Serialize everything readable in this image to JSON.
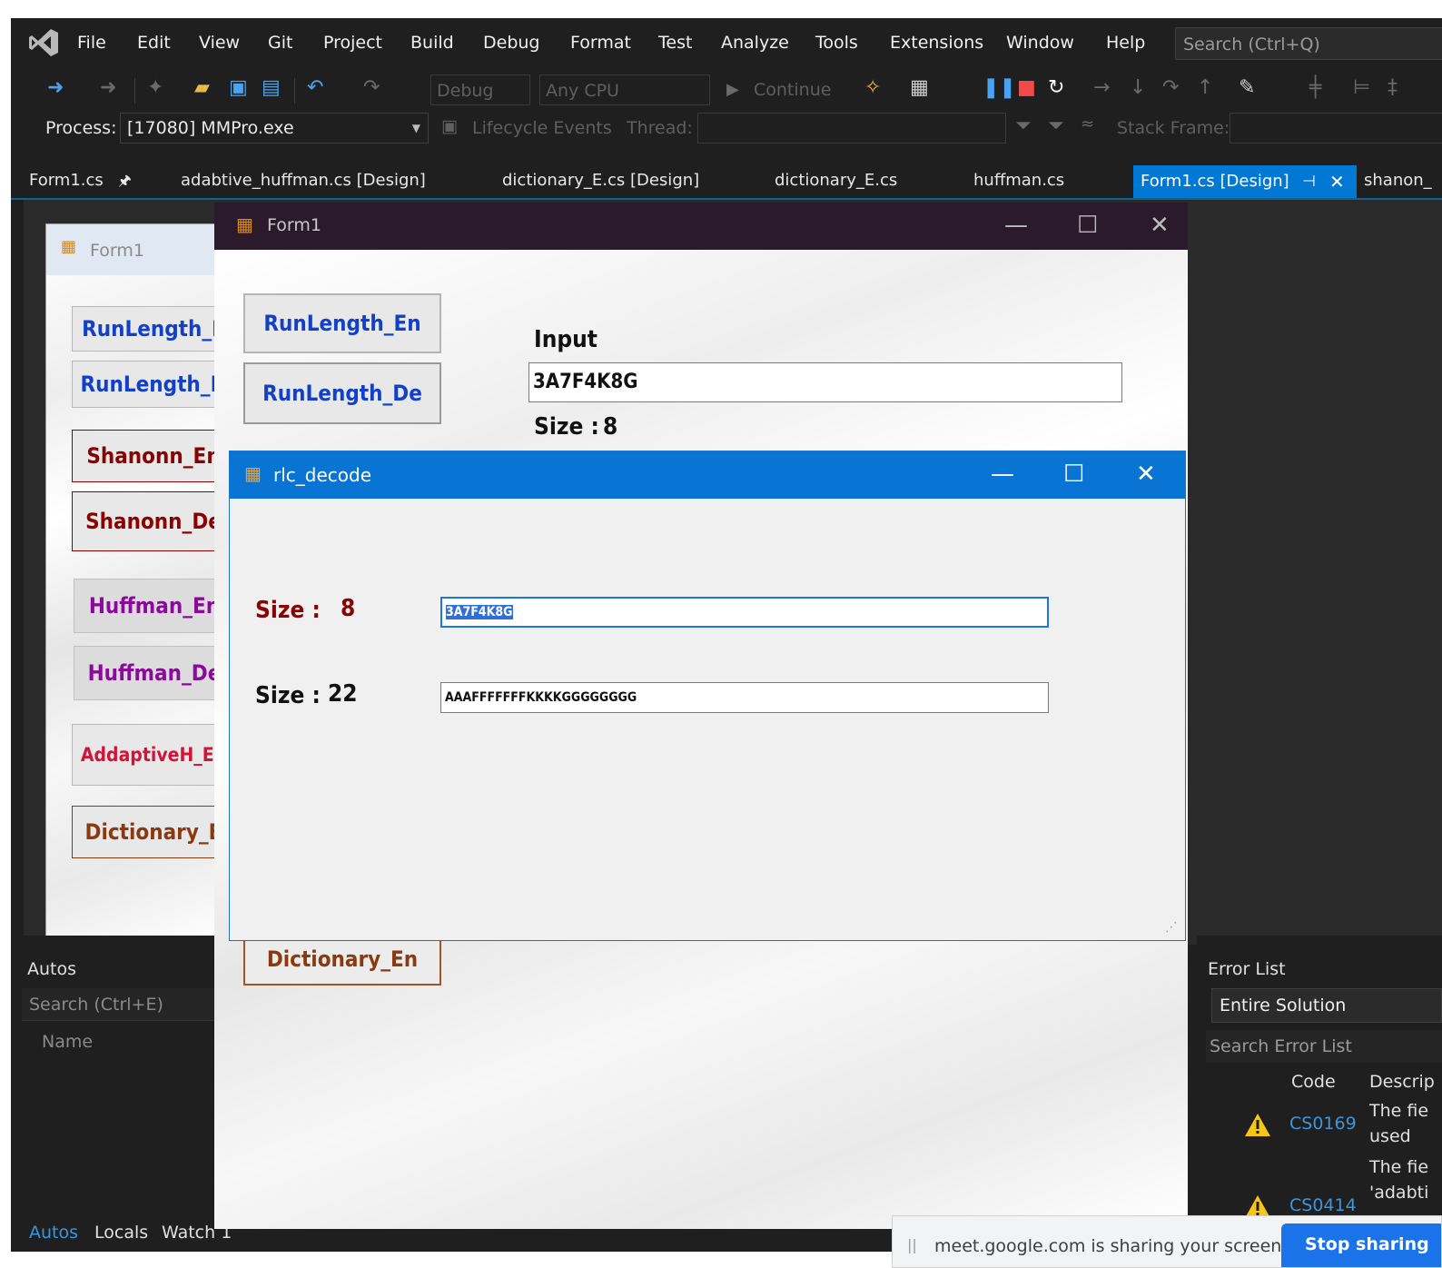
{
  "menu": {
    "items": [
      "File",
      "Edit",
      "View",
      "Git",
      "Project",
      "Build",
      "Debug",
      "Format",
      "Test",
      "Analyze",
      "Tools",
      "Extensions",
      "Window",
      "Help"
    ],
    "search_placeholder": "Search (Ctrl+Q)"
  },
  "toolbar": {
    "config": "Debug",
    "platform": "Any CPU",
    "continue_label": "Continue"
  },
  "toolbar2": {
    "process_label": "Process:",
    "process_value": "[17080] MMPro.exe",
    "lifecycle_label": "Lifecycle Events",
    "thread_label": "Thread:",
    "stack_frame_label": "Stack Frame:"
  },
  "tabs": {
    "items": [
      "Form1.cs",
      "adabtive_huffman.cs [Design]",
      "dictionary_E.cs [Design]",
      "dictionary_E.cs",
      "huffman.cs"
    ],
    "active": "Form1.cs [Design]",
    "overflow": "shanon_"
  },
  "form_back": {
    "title": "Form1",
    "buttons": [
      "RunLength_E",
      "RunLength_D",
      "Shanonn_En",
      "Shanonn_De",
      "Huffman_En",
      "Huffman_De",
      "AddaptiveH_En",
      "Dictionary_E"
    ]
  },
  "form1": {
    "title": "Form1",
    "btn_encode": "RunLength_En",
    "btn_decode": "RunLength_De",
    "btn_dictionary": "Dictionary_En",
    "input_label": "Input",
    "input_value": "3A7F4K8G",
    "size_label": "Size :",
    "size_value": "8"
  },
  "dialog": {
    "title": "rlc_decode",
    "size_label_1": "Size :",
    "size_value_1": "8",
    "input_value": "3A7F4K8G",
    "size_label_2": "Size :",
    "size_value_2": "22",
    "output_value": "AAAFFFFFFFKKKKGGGGGGGG"
  },
  "autos": {
    "title": "Autos",
    "search_placeholder": "Search (Ctrl+E)",
    "col_name": "Name",
    "bottom_tabs": [
      "Autos",
      "Locals",
      "Watch 1"
    ]
  },
  "error_list": {
    "title": "Error List",
    "scope": "Entire Solution",
    "search_placeholder": "Search Error List",
    "col_code": "Code",
    "col_desc": "Descrip",
    "rows": [
      {
        "code": "CS0169",
        "desc_1": "The fie",
        "desc_2": "used"
      },
      {
        "code": "CS0414",
        "desc_1": "The fie",
        "desc_2": "'adabti"
      }
    ]
  },
  "meet": {
    "message": "meet.google.com is sharing your screen.",
    "stop_label": "Stop sharing"
  }
}
